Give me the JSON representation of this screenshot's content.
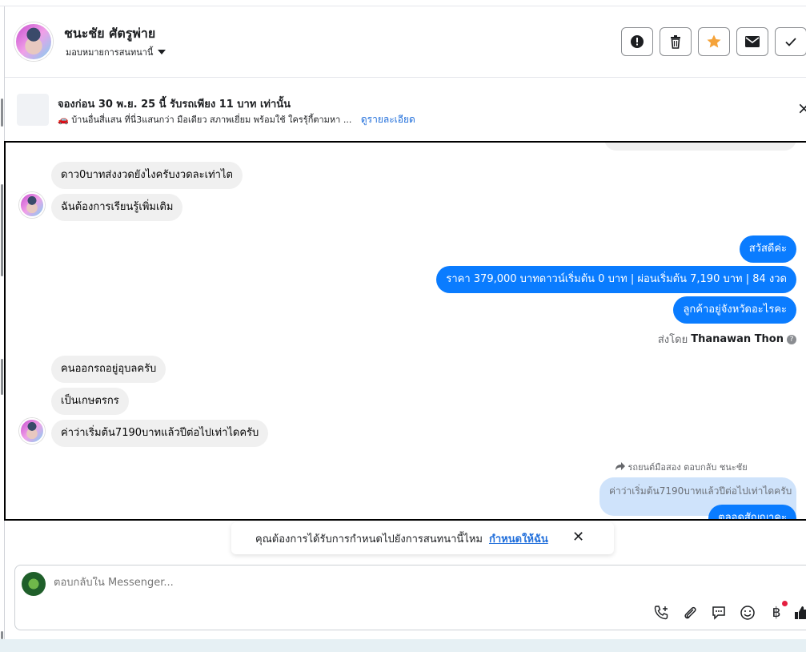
{
  "header": {
    "name": "ชนะชัย ศัตรูพ่าย",
    "assign_label": "มอบหมายการสนทนานี้"
  },
  "promo": {
    "title": "จองก่อน 30 พ.ย. 25 นี้ รับรถเพียง 11 บาท เท่านั้น",
    "desc": "🚗 บ้านอื่นสี่แสน ที่นี่3แสนกว่า มือเดียว สภาพเยี่ยม พร้อมใช้ ใครรุ้กี้ตามหา ...",
    "link": "ดูรายละเอียด"
  },
  "messages": {
    "in1": "ดาว0บาทส่งงวดยังไงครับงวดละเท่าไต",
    "in2": "ฉันต้องการเรียนรู้เพิ่มเติม",
    "out1": "สวัสดีค่ะ",
    "out2": "ราคา 379,000 บาทดาวน์เริ่มต้น 0 บาท | ผ่อนเริ่มต้น 7,190 บาท | 84 งวด",
    "out3": "ลูกค้าอยู่จังหวัดอะไรคะ",
    "sent_by_prefix": "ส่งโดย",
    "sent_by_name": "Thanawan Thon",
    "in3": "คนออกรถอยู่อุบลครับ",
    "in4": "เป็นเกษตรกร",
    "in5": "ค่าว่าเริ่มต้น7190บาทแล้วปีต่อไปเท่าไดครับ",
    "reply_note": "รถยนต์มือสอง ตอบกลับ ชนะชัย",
    "quoted": "ค่าว่าเริ่มต้น7190บาทแล้วปีต่อไปเท่าไดครับ",
    "out4": "ตลอดสัญญาคะ"
  },
  "suggestion": {
    "text": "คุณต้องการได้รับการกำหนดไปยังการสนทนานี้ไหม",
    "link": "กำหนดให้ฉัน"
  },
  "composer": {
    "placeholder": "ตอบกลับใน Messenger..."
  }
}
